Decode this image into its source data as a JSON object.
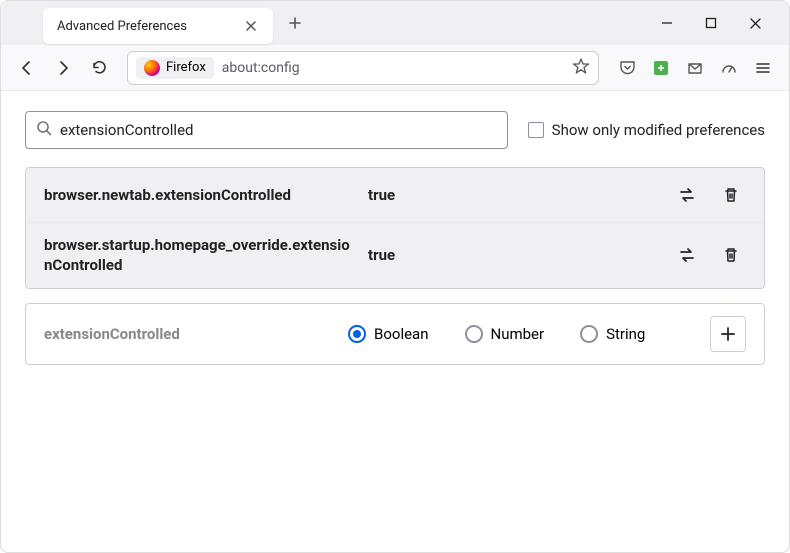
{
  "window": {
    "tab_title": "Advanced Preferences"
  },
  "urlbar": {
    "identity_label": "Firefox",
    "url": "about:config"
  },
  "search": {
    "value": "extensionControlled",
    "checkbox_label": "Show only modified preferences"
  },
  "prefs": [
    {
      "name": "browser.newtab.extensionControlled",
      "value": "true"
    },
    {
      "name": "browser.startup.homepage_override.extensionControlled",
      "value": "true"
    }
  ],
  "new_pref": {
    "name": "extensionControlled",
    "types": [
      "Boolean",
      "Number",
      "String"
    ],
    "selected": "Boolean"
  }
}
